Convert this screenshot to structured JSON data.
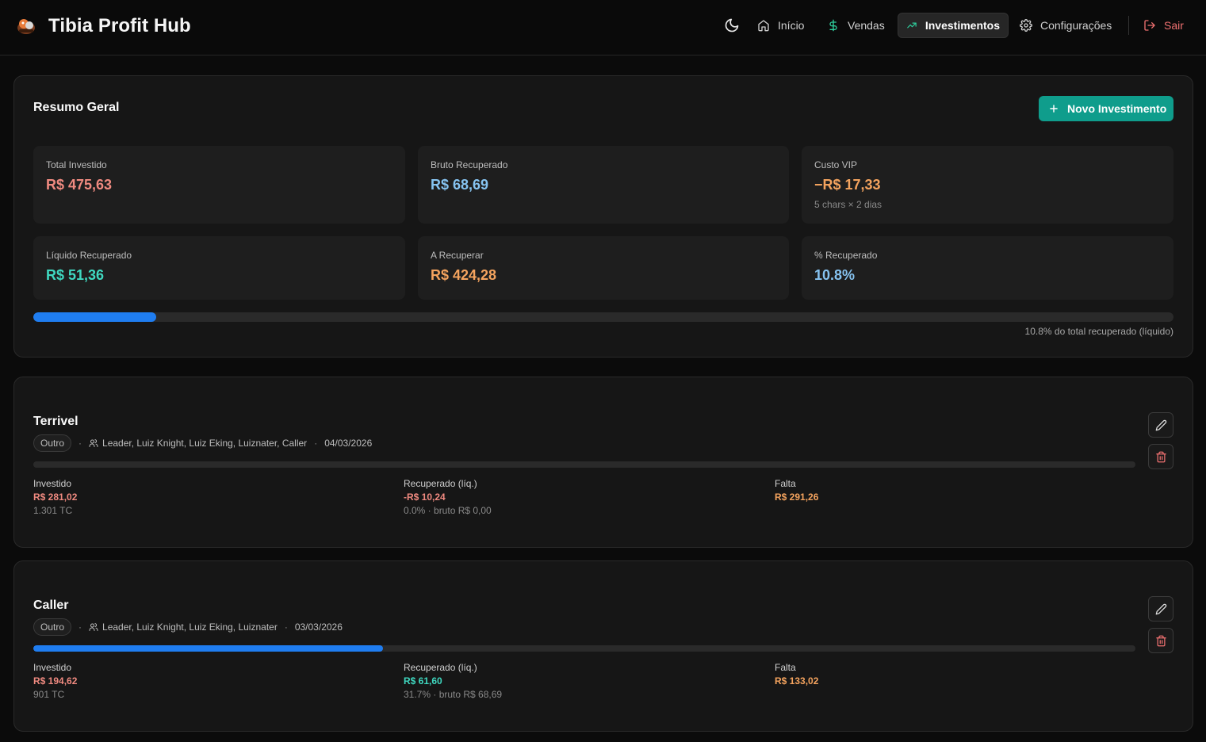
{
  "app": {
    "title": "Tibia Profit Hub"
  },
  "nav": {
    "items": [
      {
        "label": "Início",
        "icon": "home-icon"
      },
      {
        "label": "Vendas",
        "icon": "dollar-icon"
      },
      {
        "label": "Investimentos",
        "icon": "trending-up-icon",
        "active": true
      },
      {
        "label": "Configurações",
        "icon": "gear-icon"
      }
    ],
    "logout_label": "Sair",
    "theme_icon": "moon-icon"
  },
  "summary": {
    "title": "Resumo Geral",
    "new_button": "Novo Investimento",
    "stats": {
      "total_investido": {
        "label": "Total Investido",
        "value": "R$ 475,63"
      },
      "bruto_recuperado": {
        "label": "Bruto Recuperado",
        "value": "R$ 68,69"
      },
      "custo_vip": {
        "label": "Custo VIP",
        "value": "−R$ 17,33",
        "sub": "5 chars × 2 dias"
      },
      "liquido_recuperado": {
        "label": "Líquido Recuperado",
        "value": "R$ 51,36"
      },
      "a_recuperar": {
        "label": "A Recuperar",
        "value": "R$ 424,28"
      },
      "pct_recuperado": {
        "label": "% Recuperado",
        "value": "10.8%"
      }
    },
    "progress_pct": 10.8,
    "progress_caption": "10.8% do total recuperado (líquido)"
  },
  "investments": [
    {
      "name": "Terrivel",
      "tag": "Outro",
      "members": "Leader, Luiz Knight, Luiz Eking, Luiznater, Caller",
      "date": "04/03/2026",
      "progress_pct": 0,
      "investido_label": "Investido",
      "investido_value": "R$ 281,02",
      "investido_sub": "1.301 TC",
      "recuperado_label": "Recuperado (líq.)",
      "recuperado_value": "-R$ 10,24",
      "recuperado_sub": "0.0% · bruto R$ 0,00",
      "falta_label": "Falta",
      "falta_value": "R$ 291,26"
    },
    {
      "name": "Caller",
      "tag": "Outro",
      "members": "Leader, Luiz Knight, Luiz Eking, Luiznater",
      "date": "03/03/2026",
      "progress_pct": 31.7,
      "investido_label": "Investido",
      "investido_value": "R$ 194,62",
      "investido_sub": "901 TC",
      "recuperado_label": "Recuperado (líq.)",
      "recuperado_value": "R$ 61,60",
      "recuperado_sub": "31.7% · bruto R$ 68,69",
      "falta_label": "Falta",
      "falta_value": "R$ 133,02"
    }
  ],
  "colors": {
    "accent": "#0f9d8c",
    "progress": "#1f7df0",
    "negative": "#f08a80",
    "positive": "#3fd8c0",
    "warning": "#f4a35e",
    "info": "#86c3f0"
  },
  "separator": "·"
}
